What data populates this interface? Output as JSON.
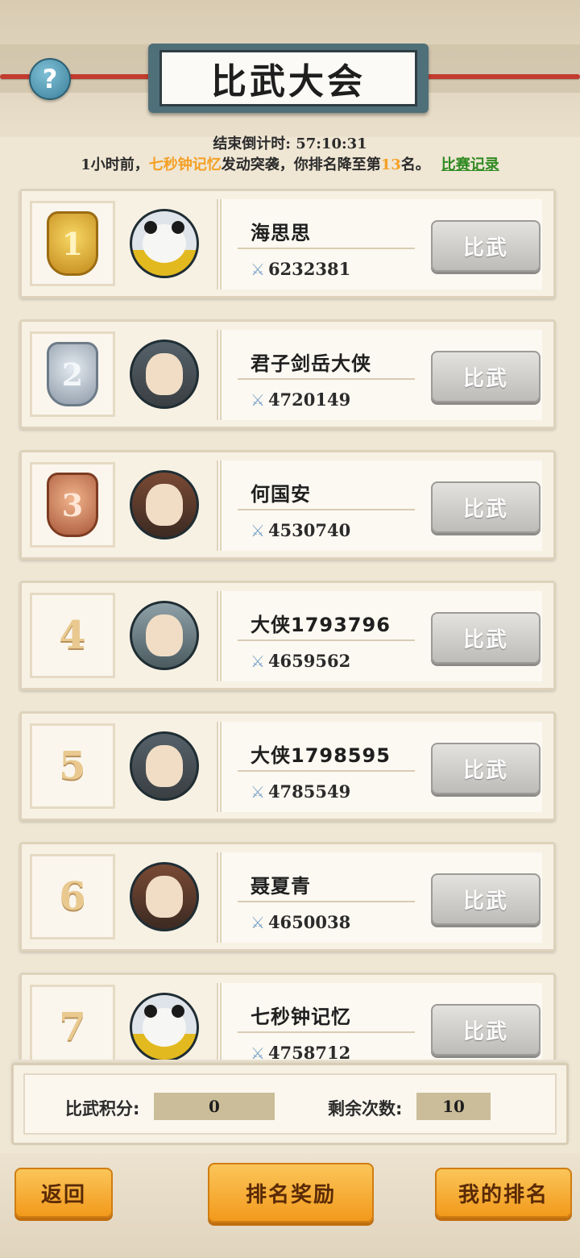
{
  "header": {
    "title": "比武大会",
    "help_label": "?",
    "countdown": "结束倒计时:  57:10:31",
    "notice": {
      "prefix": "1小时前，",
      "attacker": "七秒钟记忆",
      "middle": "发动突袭，你排名降至第",
      "rank": "13",
      "suffix": "名。",
      "record_link": "比赛记录"
    }
  },
  "duel_label": "比武",
  "players": [
    {
      "rank": "1",
      "name": "海思思",
      "power": "6232381",
      "medal": "gold",
      "avatar": "panda"
    },
    {
      "rank": "2",
      "name": "君子剑岳大侠",
      "power": "4720149",
      "medal": "silver",
      "avatar": "scholar"
    },
    {
      "rank": "3",
      "name": "何国安",
      "power": "4530740",
      "medal": "bronze",
      "avatar": "warrior"
    },
    {
      "rank": "4",
      "name": "大侠1793796",
      "power": "4659562",
      "medal": "none",
      "avatar": "youth"
    },
    {
      "rank": "5",
      "name": "大侠1798595",
      "power": "4785549",
      "medal": "none",
      "avatar": "scholar"
    },
    {
      "rank": "6",
      "name": "聂夏青",
      "power": "4650038",
      "medal": "none",
      "avatar": "warrior"
    },
    {
      "rank": "7",
      "name": "七秒钟记忆",
      "power": "4758712",
      "medal": "none",
      "avatar": "panda"
    }
  ],
  "stats": {
    "score_label": "比武积分:",
    "score_value": "0",
    "remaining_label": "剩余次数:",
    "remaining_value": "10"
  },
  "footer": {
    "back_label": "返回",
    "rewards_label": "排名奖励",
    "my_rank_label": "我的排名"
  },
  "colors": {
    "accent_orange": "#f4a024",
    "link_green": "#2f8a21",
    "button_orange": "#f29a1c"
  }
}
